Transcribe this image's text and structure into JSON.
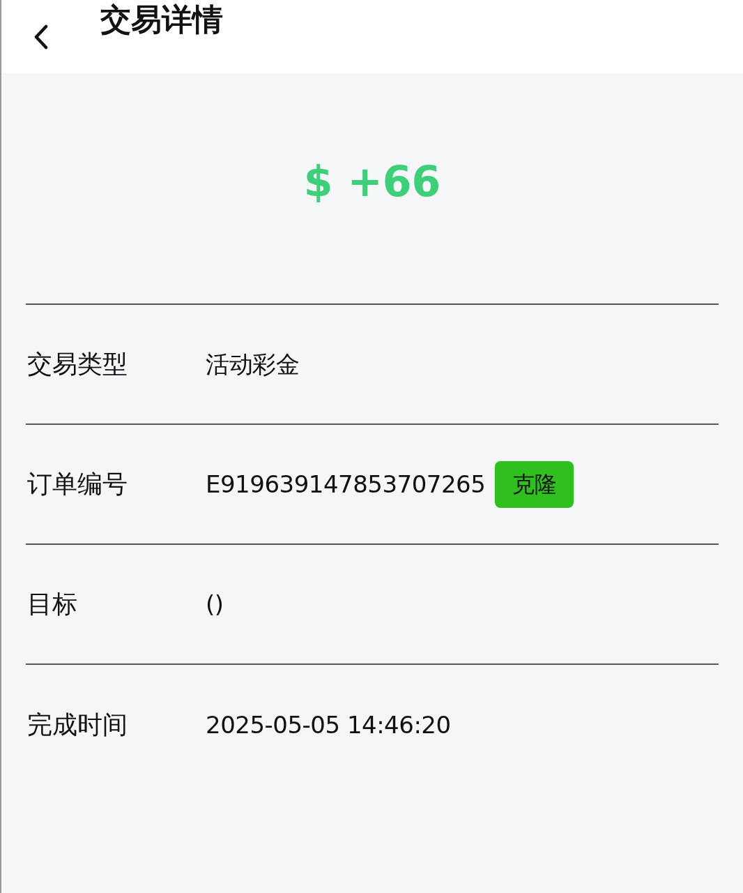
{
  "header": {
    "title": "交易详情"
  },
  "amount": "$ +66",
  "rows": [
    {
      "label": "交易类型",
      "value": "活动彩金"
    },
    {
      "label": "订单编号",
      "value": "E919639147853707265",
      "button": "克隆"
    },
    {
      "label": "目标",
      "value": "()"
    },
    {
      "label": "完成时间",
      "value": "2025-05-05 14:46:20"
    }
  ]
}
